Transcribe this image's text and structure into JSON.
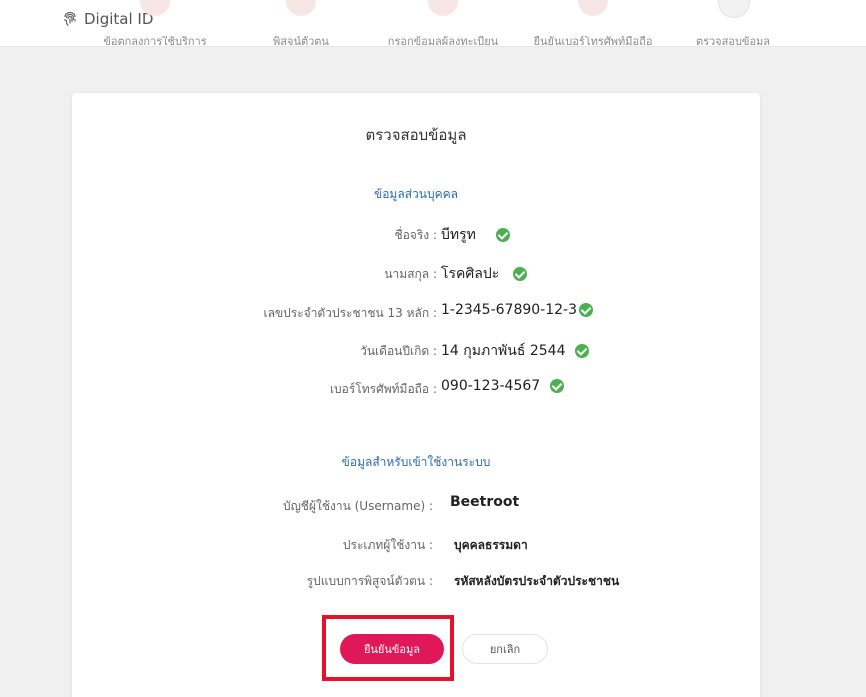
{
  "header": {
    "brand": "Digital ID",
    "steps": [
      {
        "label": "ข้อตกลงการใช้บริการ"
      },
      {
        "label": "พิสูจน์ตัวตน"
      },
      {
        "label": "กรอกข้อมูลผู้ลงทะเบียน"
      },
      {
        "label": "ยืนยันเบอร์โทรศัพท์มือถือ"
      },
      {
        "label": "ตรวจสอบข้อมูล"
      }
    ]
  },
  "card": {
    "title": "ตรวจสอบข้อมูล",
    "personal": {
      "heading": "ข้อมูลส่วนบุคคล",
      "first_name": {
        "label": "ชื่อจริง :",
        "value": "บีทรูท"
      },
      "last_name": {
        "label": "นามสกุล :",
        "value": "โรคศิลปะ"
      },
      "citizen_id": {
        "label": "เลขประจำตัวประชาชน 13 หลัก :",
        "value": "1-2345-67890-12-3"
      },
      "birth_date": {
        "label": "วันเดือนปีเกิด :",
        "value": "14 กุมภาพันธ์ 2544"
      },
      "mobile": {
        "label": "เบอร์โทรศัพท์มือถือ :",
        "value": "090-123-4567"
      }
    },
    "system": {
      "heading": "ข้อมูลสำหรับเข้าใช้งานระบบ",
      "username": {
        "label": "บัญชีผู้ใช้งาน (Username) :",
        "value": "Beetroot"
      },
      "user_type": {
        "label": "ประเภทผู้ใช้งาน :",
        "value": "บุคคลธรรมดา"
      },
      "auth_method": {
        "label": "รูปแบบการพิสูจน์ตัวตน :",
        "value": "รหัสหลังบัตรประจำตัวประชาชน"
      }
    },
    "buttons": {
      "confirm": "ยืนยันข้อมูล",
      "cancel": "ยกเลิก"
    }
  },
  "colors": {
    "accent": "#e0185a",
    "section_heading": "#2b6cb0",
    "verified": "#4caf50",
    "highlight": "#e8102a"
  }
}
